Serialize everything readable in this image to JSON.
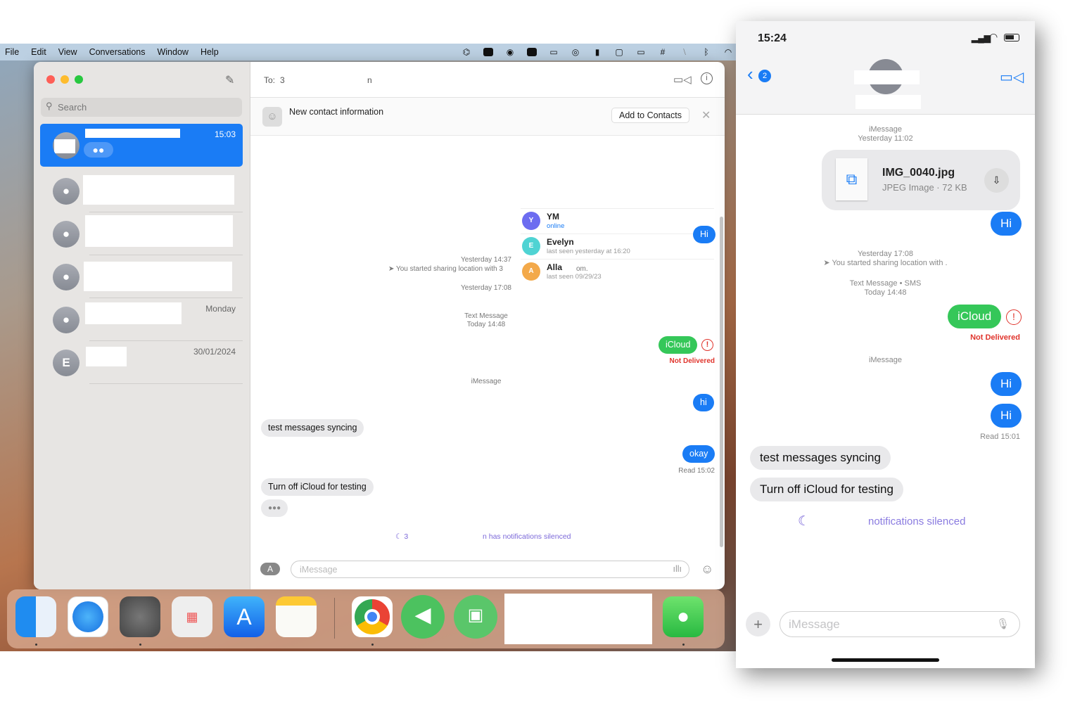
{
  "menubar": {
    "items": [
      "File",
      "Edit",
      "View",
      "Conversations",
      "Window",
      "Help"
    ],
    "status_icons": [
      "creative-cloud-icon",
      "app-icon",
      "record-icon",
      "app2-icon",
      "screen-mirror-icon",
      "airdrop-icon",
      "battery-full-icon",
      "display-icon",
      "battery-icon",
      "hashtag-icon",
      "mute-icon",
      "bluetooth-icon",
      "wifi-icon"
    ]
  },
  "sidebar": {
    "search_placeholder": "Search",
    "conversations": [
      {
        "time": "15:03",
        "selected": true
      },
      {
        "time": ""
      },
      {
        "time": ""
      },
      {
        "time": ""
      },
      {
        "time": "Monday"
      },
      {
        "initial": "E",
        "time": "30/01/2024"
      }
    ]
  },
  "chat": {
    "to_label": "To:",
    "to_value_fragment_start": "3",
    "to_value_fragment_end": "n",
    "banner": {
      "title": "New contact information",
      "add_button": "Add to Contacts"
    },
    "contacts": [
      {
        "initial": "Y",
        "name": "YM",
        "status": "online",
        "color": "#6c6cf0"
      },
      {
        "initial": "E",
        "name": "Evelyn",
        "status": "last seen yesterday at 16:20",
        "color": "#4fd3d3"
      },
      {
        "initial": "A",
        "name": "Alla",
        "status": "last seen 09/29/23",
        "color": "#f3a94a"
      }
    ],
    "messages": {
      "hi1": "Hi",
      "ts1": "Yesterday 14:37",
      "location": "You started sharing location with 3",
      "location_end": "om.",
      "ts2": "Yesterday 17:08",
      "svc": "Text Message",
      "ts3": "Today 14:48",
      "icloud": "iCloud",
      "not_delivered": "Not Delivered",
      "svc2": "iMessage",
      "hi2": "hi",
      "recv1": "test messages syncing",
      "okay": "okay",
      "read": "Read 15:02",
      "recv2": "Turn off iCloud for testing"
    },
    "silenced_prefix": "3",
    "silenced_suffix": "n has notifications silenced",
    "input_placeholder": "iMessage"
  },
  "dock": {
    "apps": [
      "Finder",
      "Safari",
      "System Settings",
      "Launchpad",
      "App Store",
      "Notes",
      "Chrome",
      "Direct Mail",
      "AirPlay Receiver",
      "Messages"
    ]
  },
  "phone": {
    "clock": "15:24",
    "back_badge": "2",
    "file": {
      "svc": "iMessage",
      "ts": "Yesterday 11:02",
      "name": "IMG_0040.jpg",
      "info": "JPEG Image · 72 KB"
    },
    "hi1": "Hi",
    "ts2": "Yesterday 17:08",
    "location": "You started sharing location with .",
    "svc2": "Text Message • SMS",
    "ts3": "Today 14:48",
    "icloud": "iCloud",
    "not_delivered": "Not Delivered",
    "svc3": "iMessage",
    "hi2": "Hi",
    "hi3": "Hi",
    "read": "Read 15:01",
    "recv1": "test messages syncing",
    "recv2": "Turn off iCloud for testing",
    "silenced": "notifications silenced",
    "input_placeholder": "iMessage"
  },
  "colors": {
    "imessage_blue": "#1a7cf5",
    "sms_green": "#35c759",
    "error_red": "#e0342c",
    "silenced_purple": "#7b68d9"
  }
}
